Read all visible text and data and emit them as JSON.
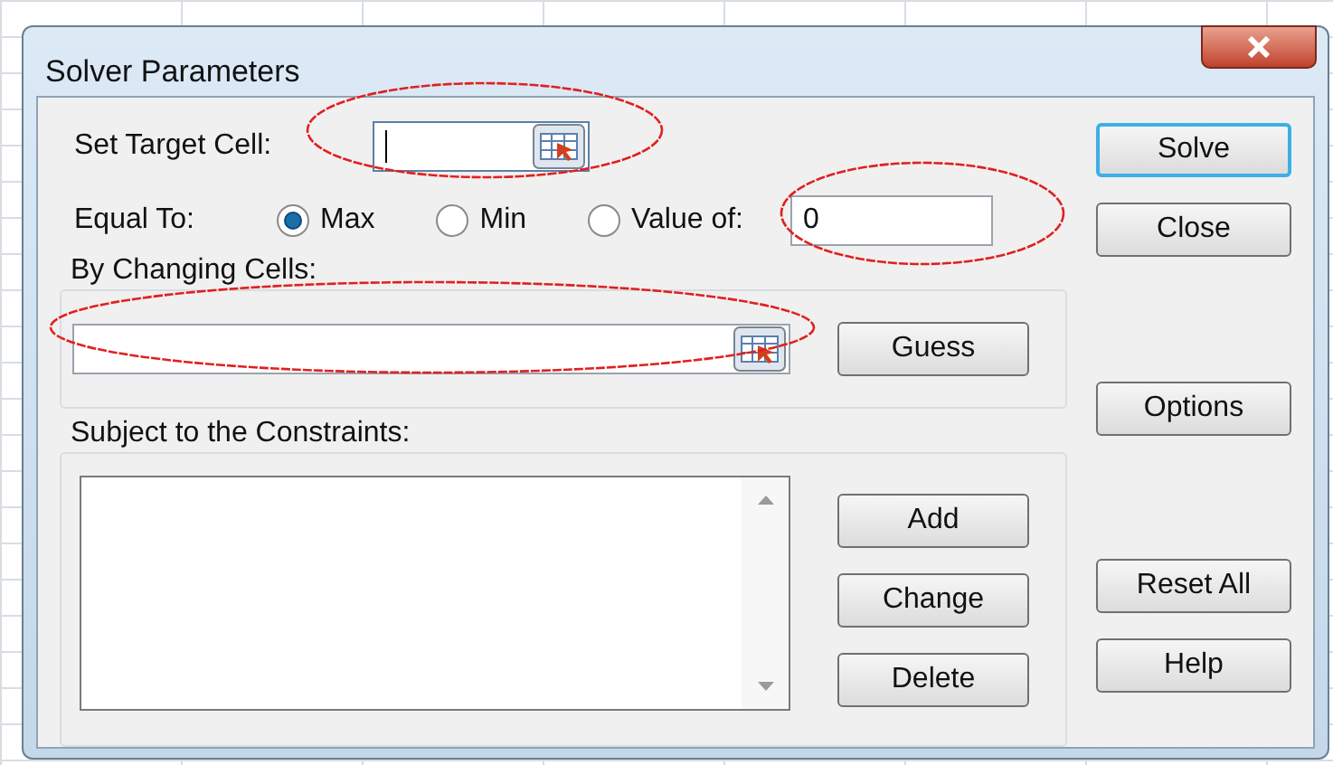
{
  "window": {
    "title": "Solver Parameters"
  },
  "target_cell": {
    "label": "Set Target Cell:",
    "focused": true
  },
  "equal_to": {
    "label": "Equal To:",
    "options": [
      {
        "label": "Max",
        "selected": true
      },
      {
        "label": "Min",
        "selected": false
      },
      {
        "label": "Value of:",
        "selected": false
      }
    ],
    "value": "0"
  },
  "changing_cells": {
    "label": "By Changing Cells:",
    "button": "Guess"
  },
  "constraints": {
    "label": "Subject to the Constraints:",
    "buttons": [
      "Add",
      "Change",
      "Delete"
    ]
  },
  "side_buttons": [
    {
      "label": "Solve",
      "default": true
    },
    {
      "label": "Close",
      "default": false
    },
    {
      "label": "Options",
      "default": false
    },
    {
      "label": "Reset All",
      "default": false
    },
    {
      "label": "Help",
      "default": false
    }
  ]
}
